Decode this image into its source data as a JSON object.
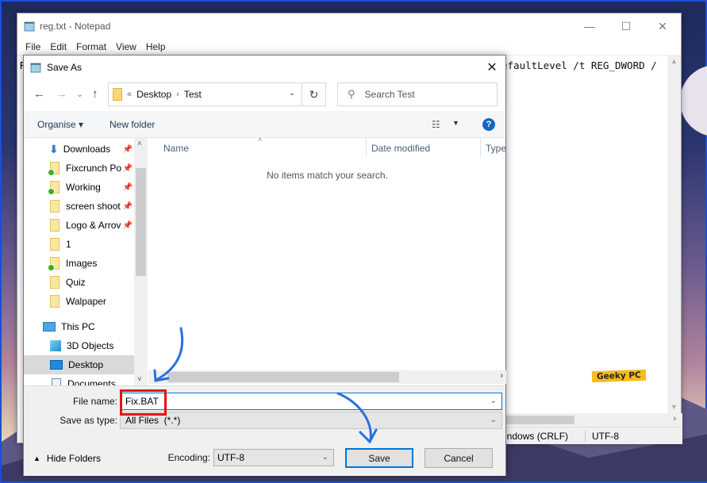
{
  "notepad": {
    "title": "reg.txt - Notepad",
    "controls": {
      "minimize": "—",
      "maximize": "☐",
      "close": "✕"
    },
    "menu": [
      "File",
      "Edit",
      "Format",
      "View",
      "Help"
    ],
    "visible_text_start": "R",
    "visible_text": "efaultLevel /t REG_DWORD /",
    "status": {
      "line_ending": "indows (CRLF)",
      "encoding": "UTF-8"
    }
  },
  "watermark": "Geeky PC",
  "dialog": {
    "title": "Save As",
    "close": "✕",
    "nav": {
      "back": "←",
      "forward": "→",
      "recent": "⌄",
      "up": "↑"
    },
    "address": {
      "overflow": "«",
      "segments": [
        "Desktop",
        "Test"
      ],
      "separator": "›"
    },
    "refresh": "↻",
    "search": {
      "placeholder": "Search Test",
      "value": ""
    },
    "toolbar": {
      "organise": "Organise ▾",
      "new_folder": "New folder",
      "help": "?"
    },
    "nav_pane": {
      "items": [
        {
          "label": "Downloads",
          "icon": "download-icon",
          "pinned": true,
          "synced": false
        },
        {
          "label": "Fixcrunch Po",
          "icon": "folder-icon",
          "pinned": true,
          "synced": true
        },
        {
          "label": "Working",
          "icon": "folder-icon",
          "pinned": true,
          "synced": true
        },
        {
          "label": "screen shoot",
          "icon": "folder-icon",
          "pinned": true,
          "synced": false
        },
        {
          "label": "Logo & Arrov",
          "icon": "folder-icon",
          "pinned": true,
          "synced": false
        },
        {
          "label": "1",
          "icon": "folder-icon",
          "pinned": false,
          "synced": false
        },
        {
          "label": "Images",
          "icon": "folder-icon",
          "pinned": false,
          "synced": true
        },
        {
          "label": "Quiz",
          "icon": "folder-icon",
          "pinned": false,
          "synced": false
        },
        {
          "label": "Walpaper",
          "icon": "folder-icon",
          "pinned": false,
          "synced": false
        },
        {
          "label": "This PC",
          "icon": "pc-icon"
        },
        {
          "label": "3D Objects",
          "icon": "cube-icon"
        },
        {
          "label": "Desktop",
          "icon": "desktop-icon",
          "selected": true
        },
        {
          "label": "Documents",
          "icon": "document-icon"
        }
      ]
    },
    "files": {
      "columns": [
        "Name",
        "Date modified",
        "Type"
      ],
      "empty_message": "No items match your search."
    },
    "form": {
      "file_name_label": "File name:",
      "file_name_value": "Fix.BAT",
      "save_as_type_label": "Save as type:",
      "save_as_type_value": "All Files  (*.*)",
      "encoding_label": "Encoding:",
      "encoding_value": "UTF-8",
      "hide_folders": "Hide Folders",
      "save": "Save",
      "cancel": "Cancel"
    }
  },
  "colors": {
    "accent": "#0078d7",
    "highlight_box": "#e8120c",
    "annotation_arrow": "#2a6fe0",
    "watermark_bg": "#f6bd18"
  }
}
